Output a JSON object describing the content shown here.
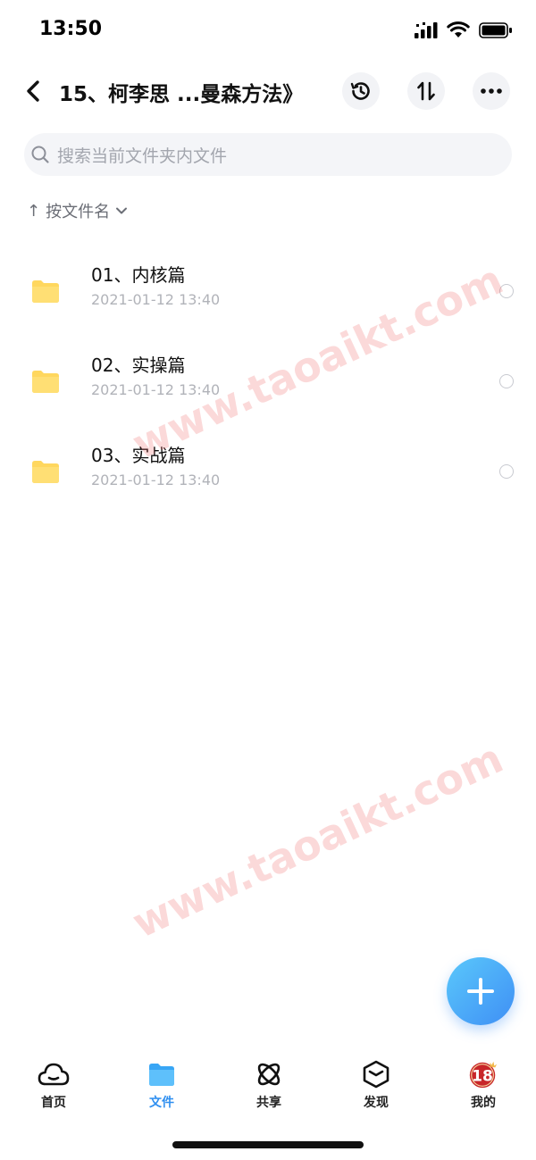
{
  "status_bar": {
    "time": "13:50"
  },
  "header": {
    "title": "15、柯李思 ...曼森方法》"
  },
  "search": {
    "placeholder": "搜索当前文件夹内文件"
  },
  "sort": {
    "arrow": "↑",
    "label": "按文件名"
  },
  "files": [
    {
      "name": "01、内核篇",
      "date": "2021-01-12 13:40"
    },
    {
      "name": "02、实操篇",
      "date": "2021-01-12 13:40"
    },
    {
      "name": "03、实战篇",
      "date": "2021-01-12 13:40"
    }
  ],
  "watermark": "www.taoaikt.com",
  "nav": [
    {
      "label": "首页",
      "icon": "cloud-face-icon"
    },
    {
      "label": "文件",
      "icon": "folder-icon"
    },
    {
      "label": "共享",
      "icon": "atom-icon"
    },
    {
      "label": "发现",
      "icon": "cube-icon"
    },
    {
      "label": "我的",
      "icon": "avatar-18-icon"
    }
  ],
  "avatar": {
    "text": "18"
  },
  "colors": {
    "accent": "#2f8ff0",
    "folder": "#ffd75e",
    "watermark": "#eb5050"
  }
}
